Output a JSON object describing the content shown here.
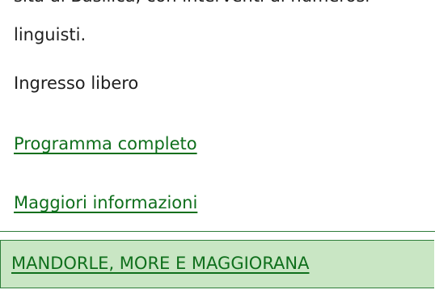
{
  "article": {
    "clipped_text": "sita di Basilica, con interventi di numerosi",
    "text_end": "linguisti.",
    "entry": "Ingresso libero",
    "program_link": "Programma completo",
    "info_link": "Maggiori informazioni"
  },
  "next_section": {
    "title": "MANDORLE, MORE E MAGGIORANA"
  },
  "colors": {
    "link": "#0f6f1c",
    "header_bg": "#c9e6c4",
    "border": "#2e7d3a"
  }
}
